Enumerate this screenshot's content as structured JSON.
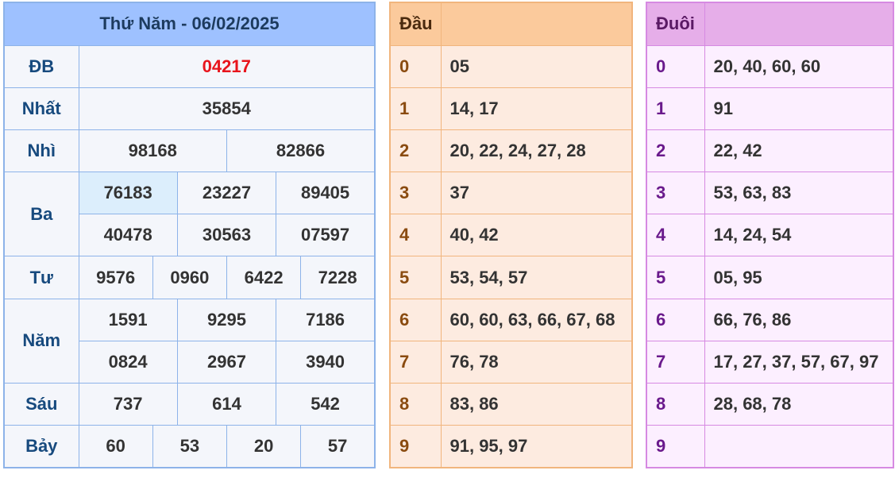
{
  "results": {
    "title": "Thứ Năm - 06/02/2025",
    "db": {
      "label": "ĐB",
      "value": "04217"
    },
    "nhat": {
      "label": "Nhất",
      "value": "35854"
    },
    "nhi": {
      "label": "Nhì",
      "values": [
        "98168",
        "82866"
      ]
    },
    "ba": {
      "label": "Ba",
      "values": [
        "76183",
        "23227",
        "89405",
        "40478",
        "30563",
        "07597"
      ]
    },
    "tu": {
      "label": "Tư",
      "values": [
        "9576",
        "0960",
        "6422",
        "7228"
      ]
    },
    "nam": {
      "label": "Năm",
      "values": [
        "1591",
        "9295",
        "7186",
        "0824",
        "2967",
        "3940"
      ]
    },
    "sau": {
      "label": "Sáu",
      "values": [
        "737",
        "614",
        "542"
      ]
    },
    "bay": {
      "label": "Bảy",
      "values": [
        "60",
        "53",
        "20",
        "57"
      ]
    }
  },
  "dau": {
    "header": "Đầu",
    "rows": [
      {
        "k": "0",
        "v": "05"
      },
      {
        "k": "1",
        "v": "14, 17"
      },
      {
        "k": "2",
        "v": "20, 22, 24, 27, 28"
      },
      {
        "k": "3",
        "v": "37"
      },
      {
        "k": "4",
        "v": "40, 42"
      },
      {
        "k": "5",
        "v": "53, 54, 57"
      },
      {
        "k": "6",
        "v": "60, 60, 63, 66, 67, 68"
      },
      {
        "k": "7",
        "v": "76, 78"
      },
      {
        "k": "8",
        "v": "83, 86"
      },
      {
        "k": "9",
        "v": "91, 95, 97"
      }
    ]
  },
  "duoi": {
    "header": "Đuôi",
    "rows": [
      {
        "k": "0",
        "v": "20, 40, 60, 60"
      },
      {
        "k": "1",
        "v": "91"
      },
      {
        "k": "2",
        "v": "22, 42"
      },
      {
        "k": "3",
        "v": "53, 63, 83"
      },
      {
        "k": "4",
        "v": "14, 24, 54"
      },
      {
        "k": "5",
        "v": "05, 95"
      },
      {
        "k": "6",
        "v": "66, 76, 86"
      },
      {
        "k": "7",
        "v": "17, 27, 37, 57, 67, 97"
      },
      {
        "k": "8",
        "v": "28, 68, 78"
      },
      {
        "k": "9",
        "v": ""
      }
    ]
  },
  "colors": {
    "results_header": "#9ec1ff",
    "special_prize": "#e8141c",
    "dau_header": "#fbca9c",
    "duoi_header": "#e6aee9"
  }
}
